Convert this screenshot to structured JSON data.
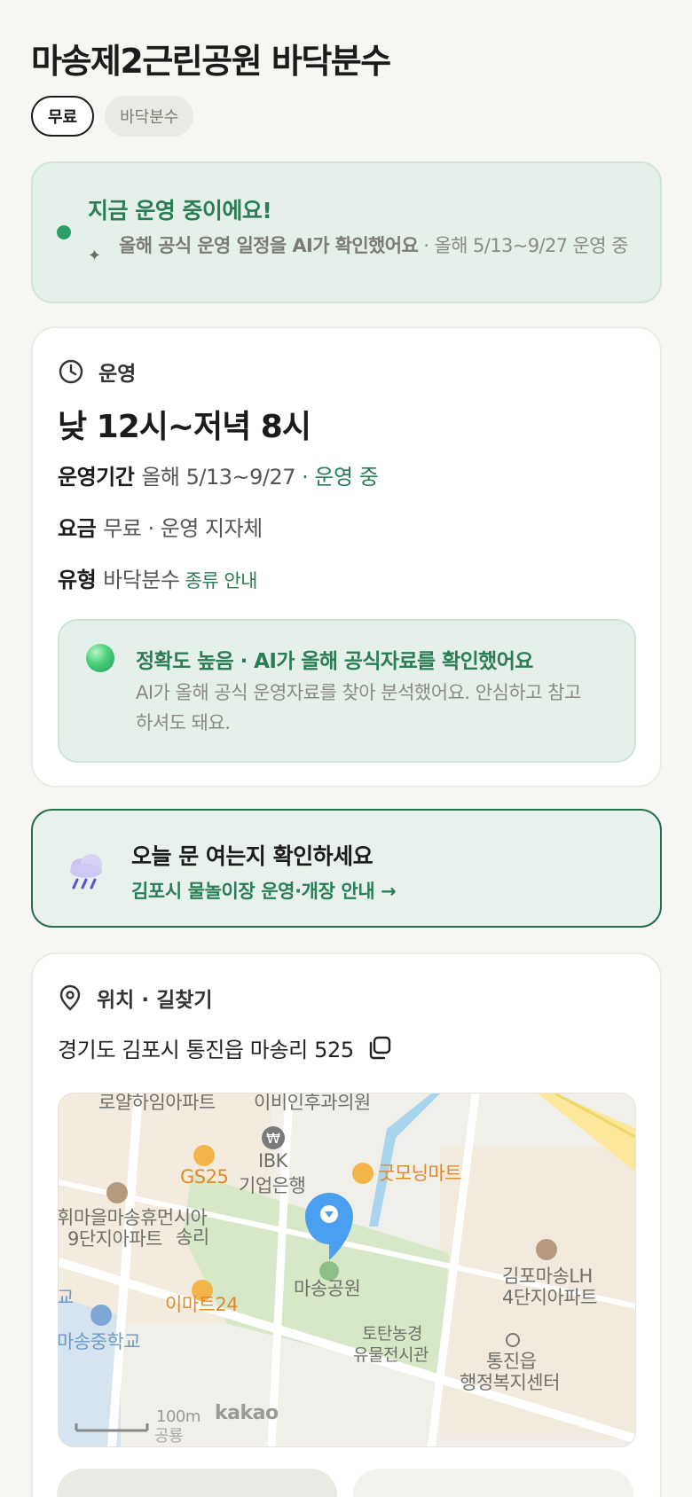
{
  "title": "마송제2근린공원 바닥분수",
  "tags": [
    "무료",
    "바닥분수"
  ],
  "status": {
    "title": "지금 운영 중이에요!",
    "sub_bold": "올해 공식 운영 일정을 AI가 확인했어요",
    "sub_rest": " · 올해 5/13~9/27 운영 중",
    "accent": "#2a7d55"
  },
  "operation": {
    "section_label": "운영",
    "hours": "낮 12시~저녁 8시",
    "period_label": "운영기간",
    "period_value": "올해 5/13~9/27",
    "period_sep": " · ",
    "period_status": "운영 중",
    "fee_label": "요금",
    "fee_value": "무료 · 운영 지자체",
    "type_label": "유형",
    "type_value": "바닥분수",
    "type_link": "종류 안내",
    "accuracy": {
      "title": "정확도 높음 · AI가 올해 공식자료를 확인했어요",
      "body": "AI가 올해 공식 운영자료를 찾아 분석했어요. 안심하고 참고하셔도 돼요."
    }
  },
  "today": {
    "title": "오늘 문 여는지 확인하세요",
    "link": "김포시 물놀이장 운영·개장 안내 →"
  },
  "location": {
    "section_label": "위치 · 길찾기",
    "address": "경기도 김포시 통진읍 마송리 525",
    "map_labels": {
      "apt_top": "로얄하임아파트",
      "clinic": "이비인후과의원",
      "gs25": "GS25",
      "ibk": "IBK",
      "ibk2": "기업은행",
      "goodmorning": "굿모닝마트",
      "apt_left1": "휘마을마송휴먼시아",
      "apt_left2": "9단지아파트",
      "songri": "송리",
      "emart": "이마트24",
      "park": "마송공원",
      "school": "마송중학교",
      "school_short": "교",
      "museum1": "토탄농경",
      "museum2": "유물전시관",
      "lh1": "김포마송LH",
      "lh2": "4단지아파트",
      "office1": "통진읍",
      "office2": "행정복지센터",
      "scale": "100m",
      "kakao": "kakao",
      "bottom": "공룡"
    }
  }
}
